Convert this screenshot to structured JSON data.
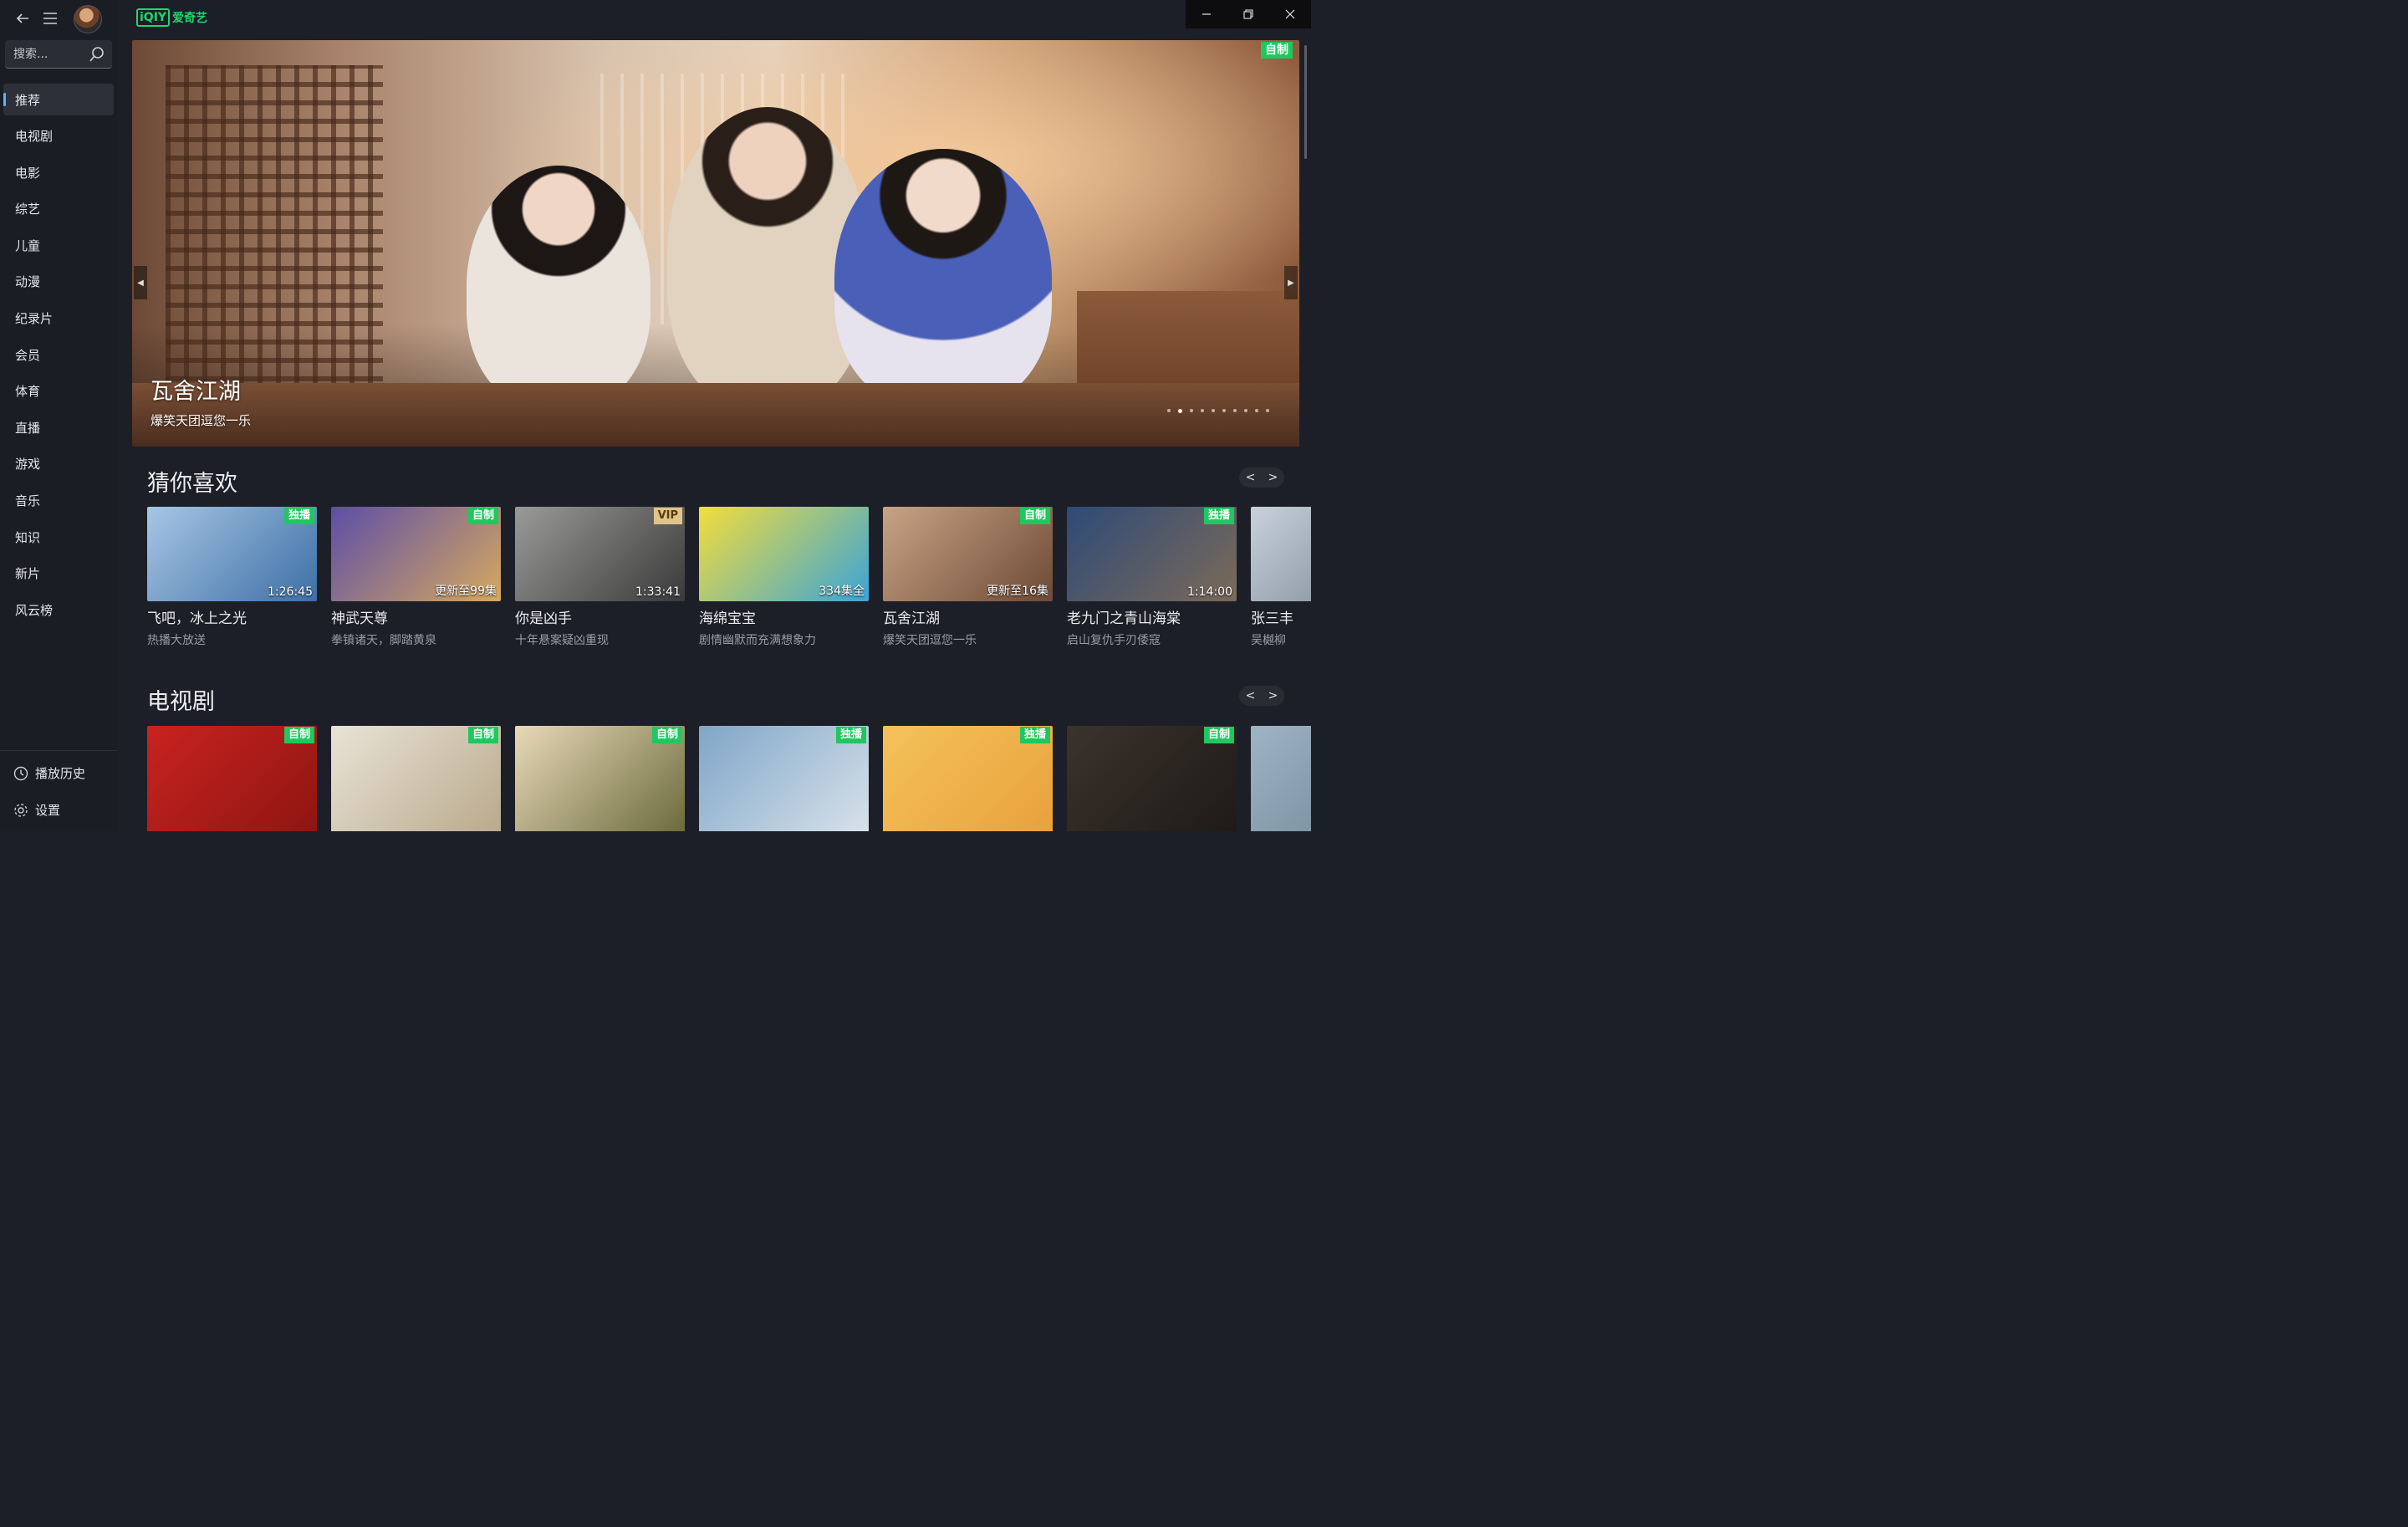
{
  "app": {
    "logo_box": "iQIY",
    "logo_text": "爱奇艺"
  },
  "search": {
    "placeholder": "搜索..."
  },
  "nav": [
    "推荐",
    "电视剧",
    "电影",
    "综艺",
    "儿童",
    "动漫",
    "纪录片",
    "会员",
    "体育",
    "直播",
    "游戏",
    "音乐",
    "知识",
    "新片",
    "风云榜"
  ],
  "nav_active": "推荐",
  "side_bottom": {
    "history": "播放历史",
    "settings": "设置"
  },
  "hero": {
    "title": "瓦舍江湖",
    "subtitle": "爆笑天团逗您一乐",
    "badge": "自制",
    "dots_count": 10,
    "active_dot": 2
  },
  "sections": {
    "guess": {
      "title": "猜你喜欢",
      "cards": [
        {
          "title": "飞吧，冰上之光",
          "subtitle": "热播大放送",
          "badge": "独播",
          "overlay": "1:26:45",
          "colors": [
            "#a7c6e4",
            "#3d6fa6"
          ]
        },
        {
          "title": "神武天尊",
          "subtitle": "拳镇诸天，脚踏黄泉",
          "badge": "自制",
          "overlay": "更新至99集",
          "colors": [
            "#5c4ea8",
            "#d7a85e"
          ]
        },
        {
          "title": "你是凶手",
          "subtitle": "十年悬案疑凶重现",
          "badge": "VIP",
          "overlay": "1:33:41",
          "colors": [
            "#9a9a98",
            "#3a3a3a"
          ]
        },
        {
          "title": "海绵宝宝",
          "subtitle": "剧情幽默而充满想象力",
          "badge": "",
          "overlay": "334集全",
          "colors": [
            "#f4dd3a",
            "#3aa5d8"
          ]
        },
        {
          "title": "瓦舍江湖",
          "subtitle": "爆笑天团逗您一乐",
          "badge": "自制",
          "overlay": "更新至16集",
          "colors": [
            "#c9a385",
            "#6d4a36"
          ]
        },
        {
          "title": "老九门之青山海棠",
          "subtitle": "启山复仇手刃倭寇",
          "badge": "独播",
          "overlay": "1:14:00",
          "colors": [
            "#2e4a78",
            "#7b6a58"
          ]
        },
        {
          "title": "张三丰",
          "subtitle": "吴樾柳",
          "badge": "",
          "overlay": "",
          "colors": [
            "#c9d2dc",
            "#6c7a88"
          ]
        }
      ]
    },
    "tv": {
      "title": "电视剧",
      "cards": [
        {
          "badge": "自制",
          "colors": [
            "#c8231f",
            "#8e1512"
          ]
        },
        {
          "badge": "自制",
          "colors": [
            "#e9e3d6",
            "#b9a98c"
          ]
        },
        {
          "badge": "自制",
          "colors": [
            "#e8d9b8",
            "#6b6a3c"
          ]
        },
        {
          "badge": "独播",
          "colors": [
            "#7fa6c8",
            "#d9e2ea"
          ]
        },
        {
          "badge": "独播",
          "colors": [
            "#f4c25a",
            "#e9a13c"
          ]
        },
        {
          "badge": "自制",
          "colors": [
            "#3b332c",
            "#1e1a16"
          ]
        },
        {
          "badge": "",
          "colors": [
            "#9fb4c4",
            "#6a8090"
          ]
        }
      ]
    }
  },
  "pager": {
    "prev": "<",
    "next": ">"
  }
}
